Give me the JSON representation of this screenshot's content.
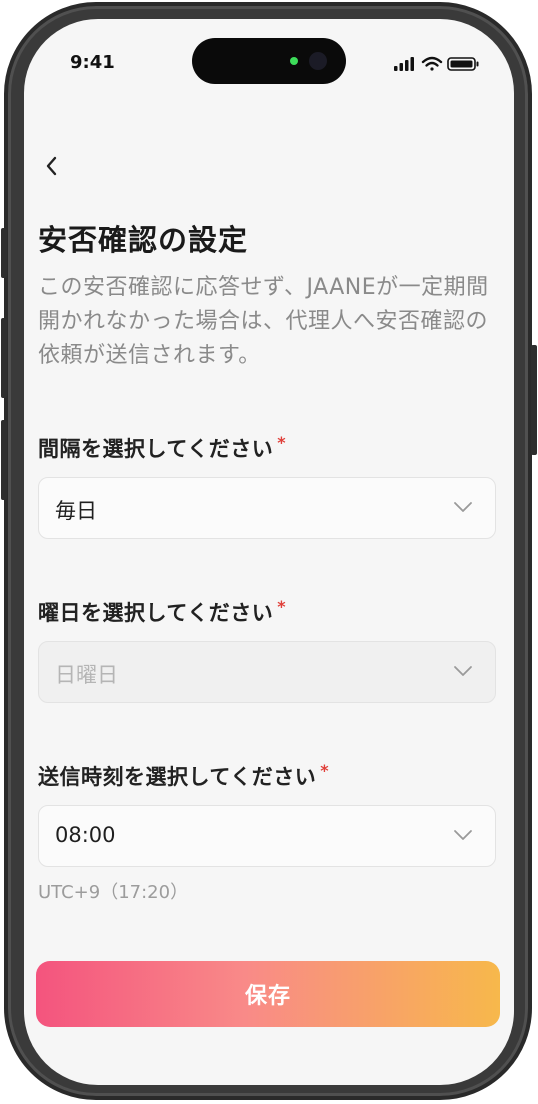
{
  "status_bar": {
    "time": "9:41",
    "icons": [
      "signal-icon",
      "wifi-icon",
      "battery-icon"
    ]
  },
  "header": {
    "back_icon": "chevron-left-icon",
    "title": "安否確認の設定",
    "description": "この安否確認に応答せず、JAANEが一定期間開かれなかった場合は、代理人へ安否確認の依頼が送信されます。"
  },
  "form": {
    "interval": {
      "label": "間隔を選択してください",
      "required_mark": "*",
      "value": "毎日",
      "disabled": false
    },
    "weekday": {
      "label": "曜日を選択してください",
      "required_mark": "*",
      "value": "日曜日",
      "disabled": true
    },
    "send_time": {
      "label": "送信時刻を選択してください",
      "required_mark": "*",
      "value": "08:00",
      "disabled": false
    },
    "timezone_note": "UTC+9（17:20）"
  },
  "actions": {
    "save_label": "保存"
  },
  "colors": {
    "required": "#e0403a",
    "button_gradient_start": "#f4547e",
    "button_gradient_end": "#f7b84b",
    "background": "#f6f6f6"
  }
}
